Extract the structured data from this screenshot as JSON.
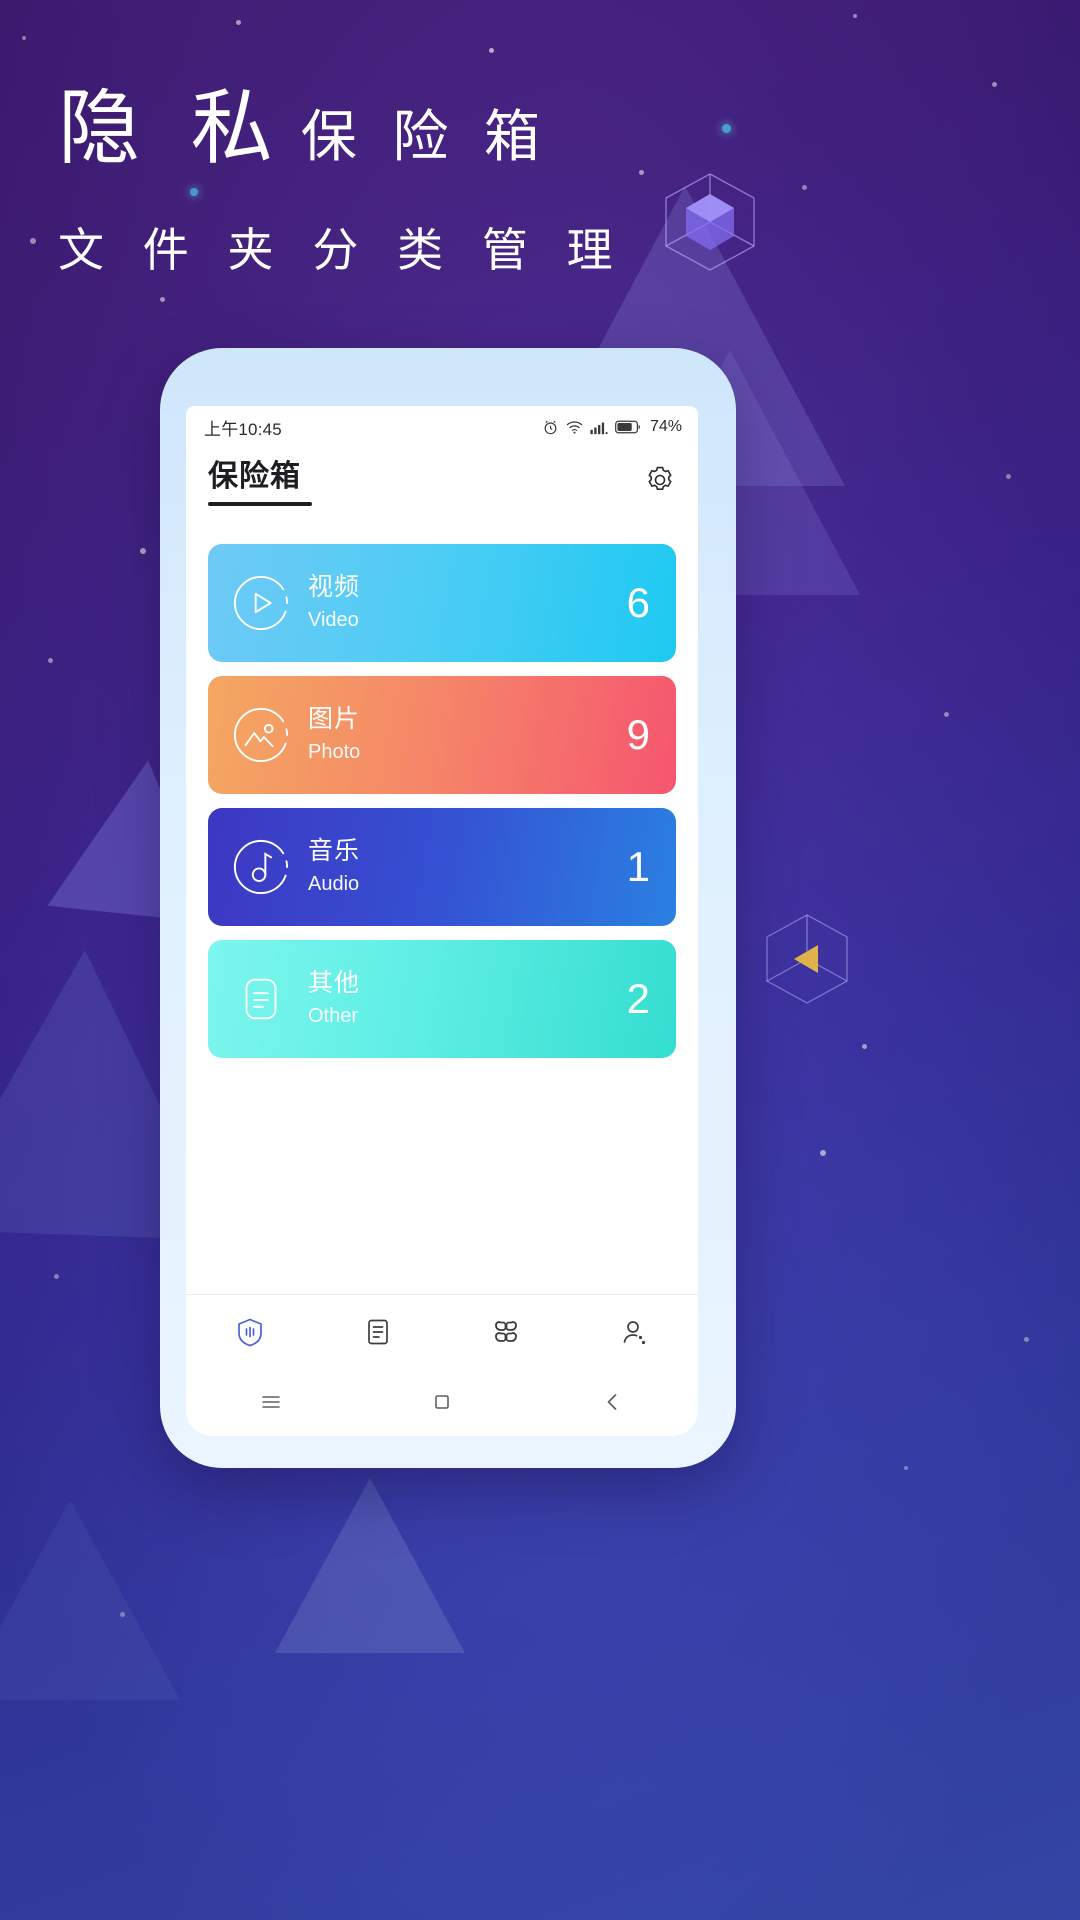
{
  "poster": {
    "headline_main": "隐 私",
    "headline_sub": "保 险 箱",
    "subheadline": "文 件 夹 分 类 管 理",
    "bg_colors": {
      "top": "#4a1f86",
      "bottom": "#3f55c9",
      "accent_star": "#4cc9f0"
    }
  },
  "phone": {
    "statusbar": {
      "time": "上午10:45",
      "battery_percent": "74%",
      "icons": [
        "alarm-icon",
        "wifi-icon",
        "signal-icon",
        "battery-icon"
      ]
    },
    "header": {
      "title": "保险箱",
      "settings_icon": "gear-icon"
    },
    "cards": [
      {
        "name_cn": "视频",
        "name_en": "Video",
        "count": "6",
        "icon": "play-circle-icon",
        "color_start": "#6ec8f5",
        "color_end": "#22c7f0"
      },
      {
        "name_cn": "图片",
        "name_en": "Photo",
        "count": "9",
        "icon": "image-mountain-icon",
        "color_start": "#f3a761",
        "color_end": "#f5596e"
      },
      {
        "name_cn": "音乐",
        "name_en": "Audio",
        "count": "1",
        "icon": "music-note-icon",
        "color_start": "#3d38c2",
        "color_end": "#2f7de0"
      },
      {
        "name_cn": "其他",
        "name_en": "Other",
        "count": "2",
        "icon": "document-icon",
        "color_start": "#74f2e8",
        "color_end": "#3de0d0"
      }
    ],
    "tabbar": [
      {
        "icon": "shield-safe-icon",
        "active": true,
        "color": "#4a63d8"
      },
      {
        "icon": "file-list-icon",
        "active": false,
        "color": "#3d3d3d"
      },
      {
        "icon": "apps-grid-icon",
        "active": false,
        "color": "#3d3d3d"
      },
      {
        "icon": "user-profile-icon",
        "active": false,
        "color": "#3d3d3d"
      }
    ],
    "navbar": [
      {
        "icon": "menu-icon"
      },
      {
        "icon": "home-square-icon"
      },
      {
        "icon": "back-chevron-icon"
      }
    ]
  }
}
